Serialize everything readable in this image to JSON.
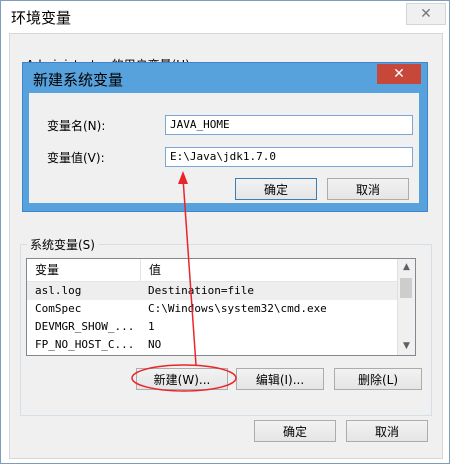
{
  "window": {
    "title": "环境变量",
    "close_label": "✕"
  },
  "user_vars": {
    "label_partial": "Administrator 的用户变量(U)"
  },
  "system_vars": {
    "label": "系统变量(S)",
    "columns": [
      "变量",
      "值"
    ],
    "rows": [
      {
        "name": "asl.log",
        "value": "Destination=file"
      },
      {
        "name": "ComSpec",
        "value": "C:\\Windows\\system32\\cmd.exe"
      },
      {
        "name": "DEVMGR_SHOW_...",
        "value": "1"
      },
      {
        "name": "FP_NO_HOST_C...",
        "value": "NO"
      }
    ],
    "buttons": {
      "new": "新建(W)...",
      "edit": "编辑(I)...",
      "delete": "删除(L)"
    }
  },
  "bottom_buttons": {
    "ok": "确定",
    "cancel": "取消"
  },
  "dialog": {
    "title": "新建系统变量",
    "close_label": "✕",
    "name_label": "变量名(N):",
    "name_value": "JAVA_HOME",
    "value_label": "变量值(V):",
    "value_value": "E:\\Java\\jdk1.7.0",
    "ok": "确定",
    "cancel": "取消"
  },
  "annotation": {
    "color": "#e8262a"
  }
}
